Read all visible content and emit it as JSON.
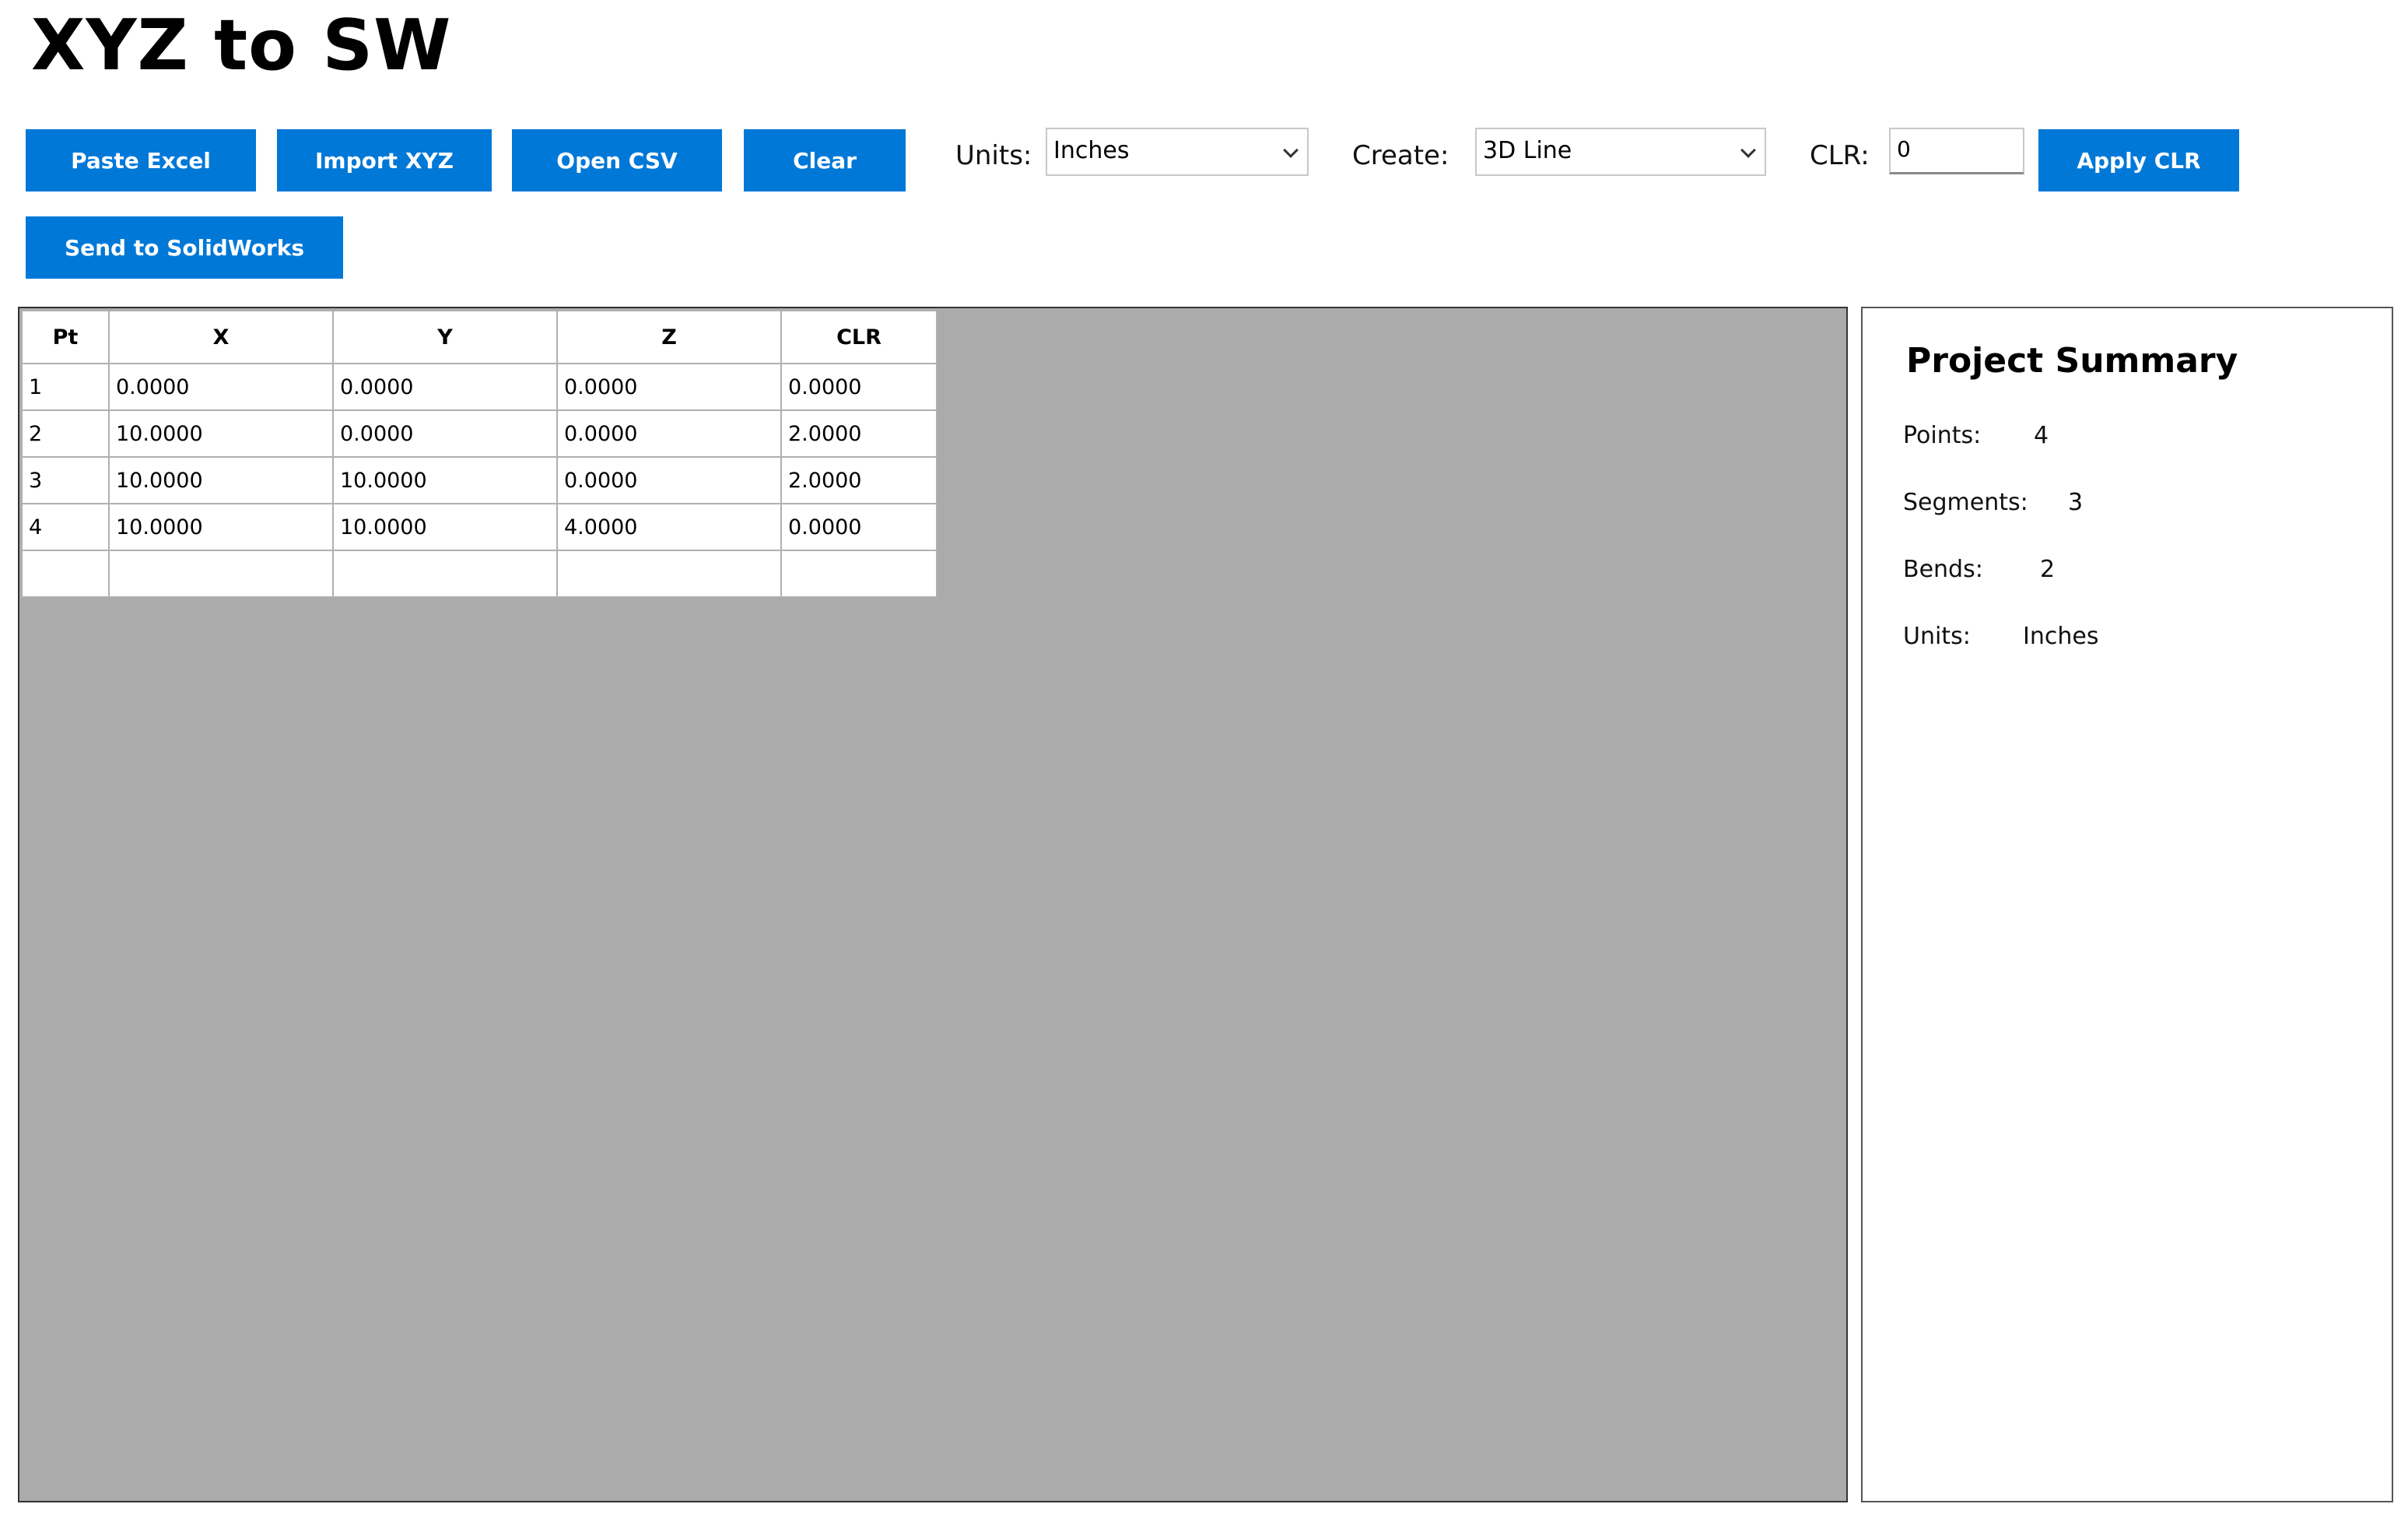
{
  "app": {
    "title": "XYZ to SW"
  },
  "toolbar": {
    "paste_excel": "Paste Excel",
    "import_xyz": "Import XYZ",
    "open_csv": "Open CSV",
    "clear": "Clear",
    "units_label": "Units:",
    "units_value": "Inches",
    "create_label": "Create:",
    "create_value": "3D Line",
    "clr_label": "CLR:",
    "clr_value": "0",
    "apply_clr": "Apply CLR",
    "send_to_solidworks": "Send to SolidWorks"
  },
  "grid": {
    "headers": [
      "Pt",
      "X",
      "Y",
      "Z",
      "CLR"
    ],
    "rows": [
      [
        "1",
        "0.0000",
        "0.0000",
        "0.0000",
        "0.0000"
      ],
      [
        "2",
        "10.0000",
        "0.0000",
        "0.0000",
        "2.0000"
      ],
      [
        "3",
        "10.0000",
        "10.0000",
        "0.0000",
        "2.0000"
      ],
      [
        "4",
        "10.0000",
        "10.0000",
        "4.0000",
        "0.0000"
      ],
      [
        "",
        "",
        "",
        "",
        ""
      ]
    ]
  },
  "summary": {
    "title": "Project Summary",
    "points_label": "Points:",
    "points_value": "4",
    "segments_label": "Segments:",
    "segments_value": "3",
    "bends_label": "Bends:",
    "bends_value": "2",
    "units_label": "Units:",
    "units_value": "Inches"
  },
  "colors": {
    "accent": "#0078d7",
    "grid_background": "#ababab"
  },
  "icons": {
    "dropdown": "chevron-down-icon"
  }
}
